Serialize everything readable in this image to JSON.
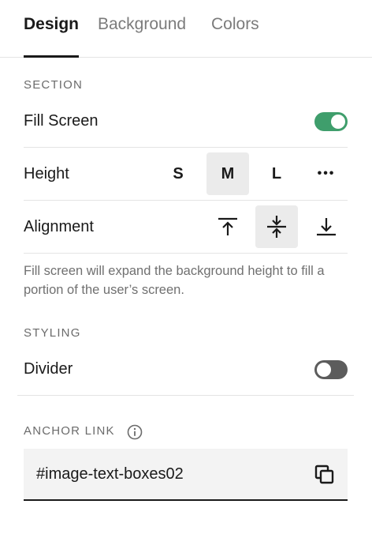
{
  "tabs": [
    {
      "label": "Design",
      "active": true
    },
    {
      "label": "Background",
      "active": false
    },
    {
      "label": "Colors",
      "active": false
    }
  ],
  "section": {
    "heading": "SECTION",
    "fill_screen": {
      "label": "Fill Screen",
      "enabled": true
    },
    "height": {
      "label": "Height",
      "options": [
        "S",
        "M",
        "L",
        "•••"
      ],
      "selected": "M"
    },
    "alignment": {
      "label": "Alignment",
      "options": [
        "align-top-icon",
        "align-center-icon",
        "align-bottom-icon"
      ],
      "selected": "align-center-icon"
    },
    "help_text": "Fill screen will expand the background height to fill a portion of the user’s screen."
  },
  "styling": {
    "heading": "STYLING",
    "divider": {
      "label": "Divider",
      "enabled": false
    }
  },
  "anchor_link": {
    "heading": "ANCHOR LINK",
    "value": "#image-text-boxes02",
    "icons": [
      "info-icon",
      "copy-icon"
    ]
  },
  "colors": {
    "toggle_on": "#3f9e6c",
    "toggle_off": "#5c5c5c",
    "selected_bg": "#ebebeb"
  }
}
